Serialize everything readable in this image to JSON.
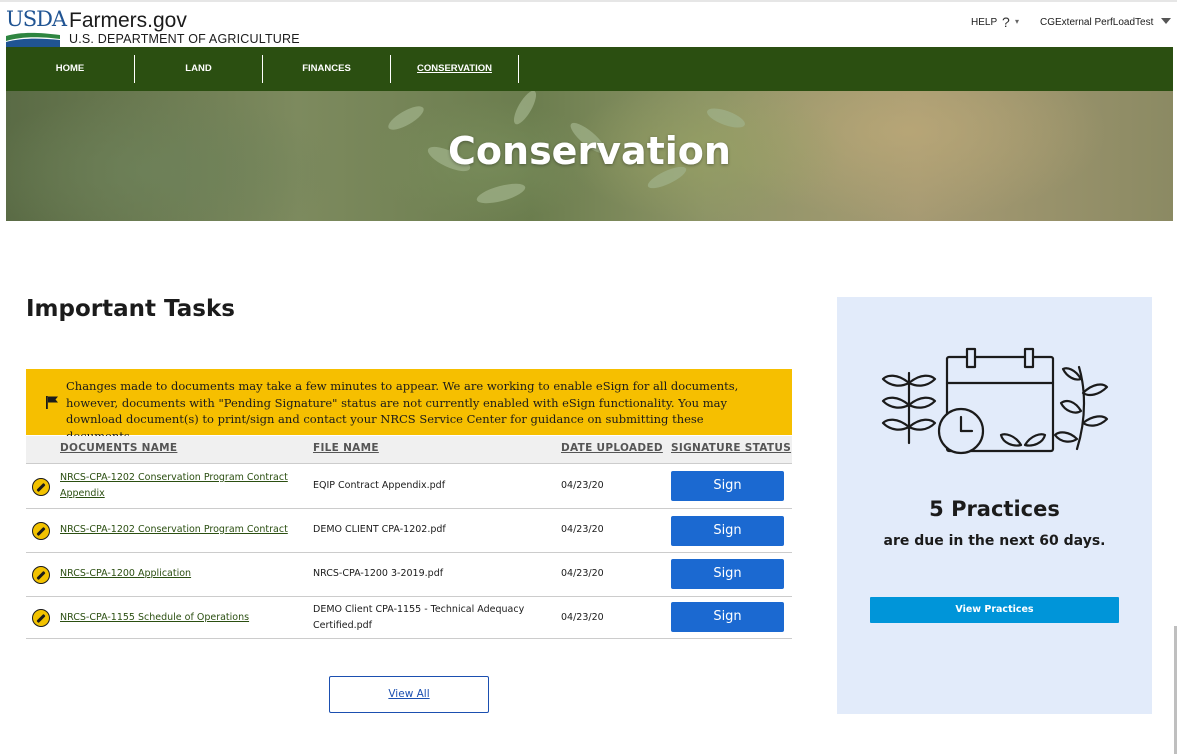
{
  "header": {
    "logo_text": "USDA",
    "site_name": "Farmers.gov",
    "site_subtitle": "U.S. DEPARTMENT OF AGRICULTURE",
    "help_label": "HELP",
    "help_icon": "?",
    "user_name": "CGExternal PerfLoadTest"
  },
  "nav": {
    "items": [
      {
        "label": "HOME"
      },
      {
        "label": "LAND"
      },
      {
        "label": "FINANCES"
      },
      {
        "label": "CONSERVATION"
      }
    ],
    "active": "CONSERVATION"
  },
  "hero": {
    "title": "Conservation"
  },
  "tasks": {
    "title": "Important Tasks",
    "notice": "Changes made to documents may take a few minutes to appear. We are working to enable eSign for all documents, however, documents with \"Pending Signature\" status are not currently enabled with eSign functionality. You may download document(s) to print/sign and contact your NRCS Service Center for guidance on submitting these documents.",
    "columns": [
      "DOCUMENTS NAME",
      "FILE NAME",
      "DATE UPLOADED",
      "SIGNATURE STATUS"
    ],
    "rows": [
      {
        "document": "NRCS-CPA-1202 Conservation Program Contract Appendix",
        "file": "EQIP Contract Appendix.pdf",
        "date": "04/23/20",
        "action": "Sign"
      },
      {
        "document": "NRCS-CPA-1202 Conservation Program Contract",
        "file": "DEMO CLIENT CPA-1202.pdf",
        "date": "04/23/20",
        "action": "Sign"
      },
      {
        "document": "NRCS-CPA-1200 Application",
        "file": "NRCS-CPA-1200 3-2019.pdf",
        "date": "04/23/20",
        "action": "Sign"
      },
      {
        "document": "NRCS-CPA-1155 Schedule of Operations",
        "file": "DEMO Client CPA-1155 - Technical Adequacy Certified.pdf",
        "date": "04/23/20",
        "action": "Sign"
      }
    ],
    "view_all_label": "View All"
  },
  "practices_card": {
    "count_label": "5 Practices",
    "subtitle": "are due in the next 60 days.",
    "button_label": "View Practices",
    "illustration_icon": "calendar-plants-icon"
  },
  "colors": {
    "nav_green": "#2b4f11",
    "notice_yellow": "#f6bf00",
    "sign_blue": "#1b69d1",
    "card_bg": "#e2ebfa",
    "card_button": "#0095d9"
  }
}
